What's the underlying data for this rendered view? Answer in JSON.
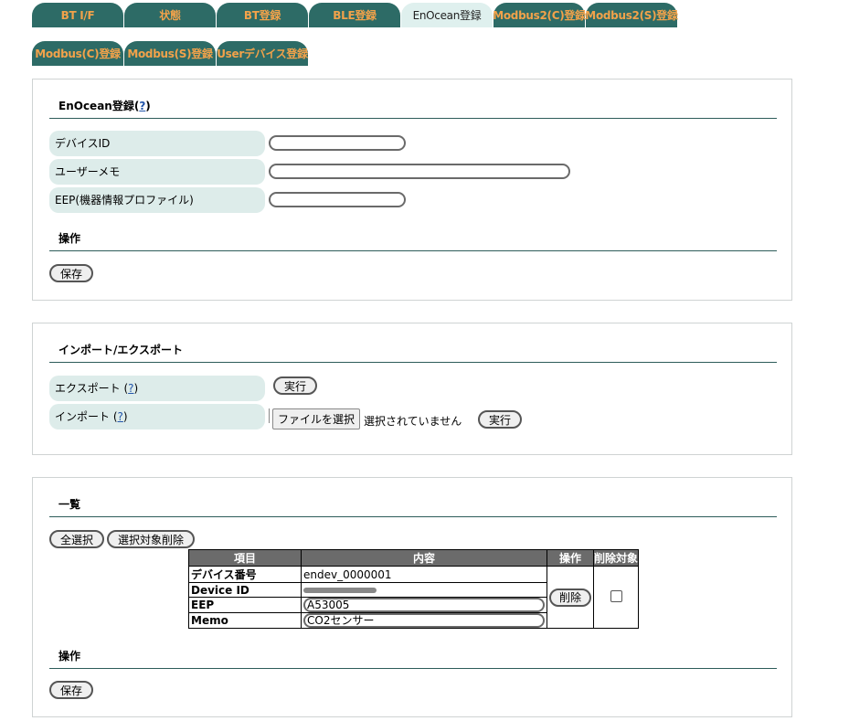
{
  "tabs": [
    {
      "label": "BT I/F"
    },
    {
      "label": "状態"
    },
    {
      "label": "BT登録"
    },
    {
      "label": "BLE登録"
    },
    {
      "label": "EnOcean登録"
    },
    {
      "label": "Modbus2(C)登録"
    },
    {
      "label": "Modbus2(S)登録"
    },
    {
      "label": "Modbus(C)登録"
    },
    {
      "label": "Modbus(S)登録"
    },
    {
      "label": "Userデバイス登録"
    }
  ],
  "register": {
    "title": "EnOcean登録(",
    "help": "?",
    "title_close": ")",
    "fields": [
      {
        "label": "デバイスID",
        "value": ""
      },
      {
        "label": "ユーザーメモ",
        "value": ""
      },
      {
        "label": "EEP(機器情報プロファイル)",
        "value": ""
      }
    ],
    "ops_title": "操作",
    "save_label": "保存"
  },
  "import_export": {
    "title": "インポート/エクスポート",
    "export_label": "エクスポート (",
    "import_label": "インポート (",
    "help": "?",
    "help_close": ")",
    "run_label": "実行",
    "file_button": "ファイルを選択",
    "file_status": "選択されていません"
  },
  "list": {
    "title": "一覧",
    "select_all": "全選択",
    "delete_selected": "選択対象削除",
    "headers": [
      "項目",
      "内容",
      "操作",
      "削除対象"
    ],
    "rows": [
      {
        "label": "デバイス番号",
        "value": "endev_0000001"
      },
      {
        "label": "Device ID",
        "value": ""
      },
      {
        "label": "EEP",
        "value": "A53005"
      },
      {
        "label": "Memo",
        "value": "CO2センサー"
      }
    ],
    "delete_label": "削除",
    "ops_title": "操作",
    "save_label": "保存"
  }
}
